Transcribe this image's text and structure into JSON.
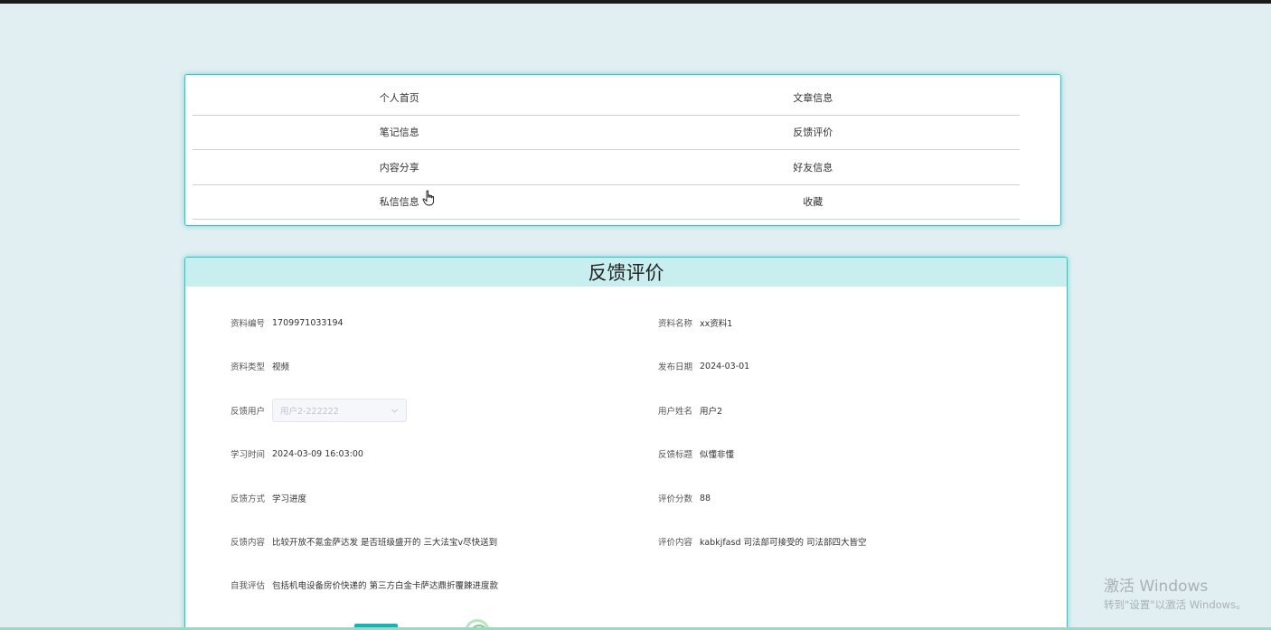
{
  "nav": {
    "items": [
      [
        "个人首页",
        "文章信息"
      ],
      [
        "笔记信息",
        "反馈评价"
      ],
      [
        "内容分享",
        "好友信息"
      ],
      [
        "私信信息",
        "收藏"
      ]
    ]
  },
  "detail": {
    "title": "反馈评价",
    "fields": {
      "material_id": {
        "label": "资料编号",
        "value": "1709971033194"
      },
      "material_name": {
        "label": "资料名称",
        "value": "xx资料1"
      },
      "material_type": {
        "label": "资料类型",
        "value": "视频"
      },
      "publish_date": {
        "label": "发布日期",
        "value": "2024-03-01"
      },
      "feedback_user": {
        "label": "反馈用户",
        "placeholder": "用户2-222222"
      },
      "user_name": {
        "label": "用户姓名",
        "value": "用户2"
      },
      "study_time": {
        "label": "学习时间",
        "value": "2024-03-09 16:03:00"
      },
      "feedback_title": {
        "label": "反馈标题",
        "value": "似懂非懂"
      },
      "feedback_method": {
        "label": "反馈方式",
        "value": "学习进度"
      },
      "score": {
        "label": "评价分数",
        "value": "88"
      },
      "feedback_content": {
        "label": "反馈内容",
        "value": "比较开放不氪金萨达发 是否班级盛开的 三大法宝v尽快送到"
      },
      "review_content": {
        "label": "评价内容",
        "value": "kabkjfasd 司法部可接受的 司法部四大皆空"
      },
      "self_eval": {
        "label": "自我评估",
        "value": "包括机电设备房价快递的 第三方白金卡萨达鼎折覆餗进度款"
      }
    }
  },
  "watermark": {
    "line1": "激活 Windows",
    "line2": "转到\"设置\"以激活 Windows。"
  },
  "colors": {
    "accent": "#2ec7c9",
    "header_bg": "#c8eeef",
    "page_bg": "#e1eef2"
  },
  "icons": {
    "cursor": "hand-pointer-icon",
    "select": "chevron-down-icon"
  }
}
